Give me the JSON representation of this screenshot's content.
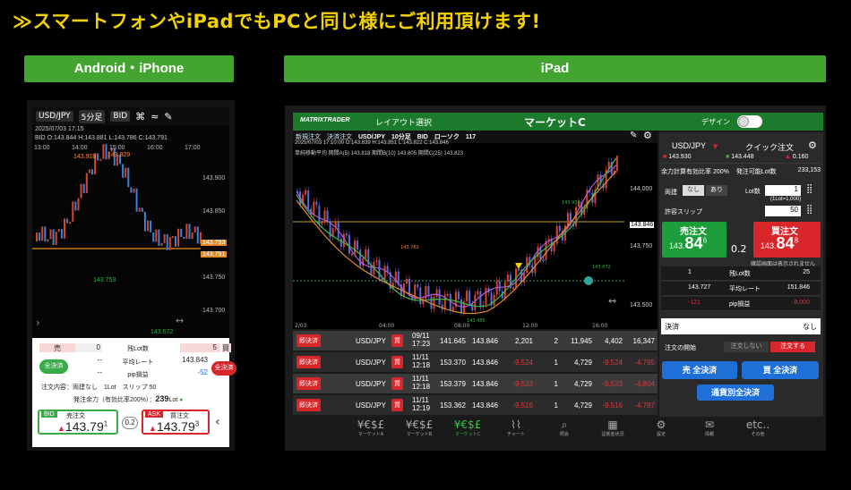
{
  "headline": "≫スマートフォンやiPadでもPCと同じ様にご利用頂けます!",
  "labels": {
    "phone": "Android・iPhone",
    "ipad": "iPad"
  },
  "phone": {
    "pair": "USD/JPY",
    "interval": "5分足",
    "side": "BID",
    "datetime": "2025/07/03 17:15",
    "ohlc": "BID O:143.844 H:143.881 L:143.786 C:143.791",
    "time_ticks": [
      "13:00",
      "14:00",
      "15:00",
      "16:00",
      "17:00"
    ],
    "price_ticks": [
      "143.900",
      "143.850",
      "143.800",
      "143.750",
      "143.700"
    ],
    "high_labels": [
      "143.928",
      "143.929"
    ],
    "low_labels": [
      "143.753",
      "143.672"
    ],
    "price_tags": [
      "143.793",
      "143.791"
    ],
    "order": {
      "sell": "売",
      "buy": "買",
      "sell_qty": "0",
      "buy_qty": "5",
      "open_lot_label": "残Lot数",
      "avg_rate_label": "平均レート",
      "avg_rate": "143.843",
      "pip_label": "pip損益",
      "pip_value": "-52",
      "dash1": "--",
      "dash2": "--",
      "close_all_left": "全決済",
      "close_all_right": "全決済",
      "order_info": "注文内容：両建なし　1Lot　スリップ 50",
      "margin_info": "発注余力（有効比率200%）：",
      "margin_value": "239",
      "margin_unit": "Lot",
      "bid_tag": "BID",
      "bid_sub": "売注文",
      "bid_price": "143.79",
      "bid_sup": "1",
      "spread": "0.2",
      "ask_tag": "ASK",
      "ask_sub": "買注文",
      "ask_price": "143.79",
      "ask_sup": "3"
    }
  },
  "ipad": {
    "logo": "MATRIXTRADER",
    "layout_select": "レイアウト選択",
    "title": "マーケットC",
    "design_label": "デザイン",
    "chart_toolbar": [
      "新規注文",
      "決済注文",
      "USD/JPY",
      "10分足",
      "BID",
      "ローソク",
      "117"
    ],
    "chart_info1": "2025/07/03 17:10:00  O:143.839 H:143.851 L:143.822 C:143.846",
    "chart_info2": "単純移動平均  期間A(5) 143.818  期間B(10) 143.805  期間C(25) 143.823",
    "price_ticks": [
      "144.000",
      "143.846",
      "143.750",
      "143.500"
    ],
    "time_ticks": [
      "2/03",
      "04:00",
      "08:00",
      "12:00",
      "16:00"
    ],
    "annotations": [
      "143.930",
      "143.761",
      "143.672",
      "143.485"
    ],
    "right": {
      "pair": "USD/JPY",
      "quick_order": "クイック注文",
      "bid_small": "143.930",
      "ask_small": "143.448",
      "spread_small": "0.160",
      "margin_row_label": "余力計算有効比率",
      "margin_ratio": "200%",
      "orderable_label": "発注可能Lot数",
      "orderable_value": "233,153",
      "hedge_label": "両建",
      "hedge_off": "なし",
      "hedge_on": "あり",
      "lot_label": "Lot数",
      "lot_value": "1",
      "lot_hint": "(1Lot=1,000)",
      "slip_label": "許容スリップ",
      "slip_value": "50",
      "sell_label": "売注文",
      "sell_price_small": "143.",
      "sell_price_big": "84",
      "sell_sup": "6",
      "spread": "0.2",
      "buy_label": "買注文",
      "buy_price_small": "143.",
      "buy_price_big": "84",
      "buy_sup": "8",
      "confirm_note": "確認画面は表示されません",
      "pos_rows": [
        {
          "left": "1",
          "label": "残Lot数",
          "right": "25"
        },
        {
          "left": "143.727",
          "label": "平均レート",
          "right": "151.846"
        },
        {
          "left": "-121",
          "label": "pip損益",
          "right": "-8,000"
        }
      ],
      "settle_label": "決済",
      "settle_value": "なし",
      "settle_start_label": "注文の開始",
      "settle_off": "注文しない",
      "settle_on": "注文する",
      "sell_all": "売 全決済",
      "buy_all": "買 全決済",
      "pair_all": "通貨別全決済"
    },
    "table_rows": [
      {
        "btn": "即決済",
        "pair": "USD/JPY",
        "side": "買",
        "date": "09/11",
        "time": "17:23",
        "open": "141.645",
        "cur": "143.846",
        "pips": "2,201",
        "lot": "2",
        "val": "11,945",
        "sw": "4,402",
        "total": "16,347",
        "neg": false
      },
      {
        "btn": "即決済",
        "pair": "USD/JPY",
        "side": "買",
        "date": "11/11",
        "time": "12:18",
        "open": "153.370",
        "cur": "143.846",
        "pips": "-9,524",
        "lot": "1",
        "val": "4,729",
        "sw": "-9,524",
        "total": "-4,795",
        "neg": true
      },
      {
        "btn": "即決済",
        "pair": "USD/JPY",
        "side": "買",
        "date": "11/11",
        "time": "12:18",
        "open": "153.379",
        "cur": "143.846",
        "pips": "-9,533",
        "lot": "1",
        "val": "4,729",
        "sw": "-9,533",
        "total": "-4,804",
        "neg": true
      },
      {
        "btn": "即決済",
        "pair": "USD/JPY",
        "side": "買",
        "date": "11/11",
        "time": "12:19",
        "open": "153.362",
        "cur": "143.846",
        "pips": "-9,516",
        "lot": "1",
        "val": "4,729",
        "sw": "-9,516",
        "total": "-4,787",
        "neg": true
      }
    ],
    "nav": [
      {
        "icon": "¥€$£",
        "label": "マーケットA"
      },
      {
        "icon": "¥€$£",
        "label": "マーケットB"
      },
      {
        "icon": "¥€$£",
        "label": "マーケットC"
      },
      {
        "icon": "chart",
        "label": "チャート"
      },
      {
        "icon": "search",
        "label": "照会"
      },
      {
        "icon": "calendar",
        "label": "証拠金状況"
      },
      {
        "icon": "gear",
        "label": "設定"
      },
      {
        "icon": "news",
        "label": "情報"
      },
      {
        "icon": "etc..",
        "label": "その他"
      }
    ]
  },
  "colors": {
    "accent_yellow": "#f3d200",
    "green": "#43a530",
    "red": "#d8262b",
    "blue": "#1f6fd8"
  }
}
